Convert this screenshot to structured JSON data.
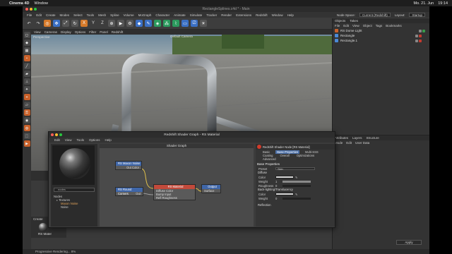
{
  "menubar": {
    "app": "Cinema 4D",
    "items": [
      "Window"
    ],
    "right": [
      "Mo. 21. Jun",
      "19:14"
    ]
  },
  "window": {
    "title": "RectangleSplines.c4d * - Main",
    "menu": [
      "File",
      "Edit",
      "Create",
      "Modes",
      "Select",
      "Tools",
      "Mesh",
      "Spline",
      "Volume",
      "MoGraph",
      "Character",
      "Animate",
      "Simulate",
      "Tracker",
      "Render",
      "Extensions",
      "Redshift",
      "Window",
      "Help"
    ],
    "node_space_label": "Node Space:",
    "node_space_value": "Current (Redshift)",
    "layout_label": "Layout:",
    "layout_value": "Startup"
  },
  "viewport": {
    "menu": [
      "View",
      "Cameras",
      "Display",
      "Options",
      "Filter",
      "Panel",
      "Redshift"
    ],
    "camera": "Default Camera",
    "label": "Perspective"
  },
  "objects": {
    "tabs": [
      "Objects",
      "Takes"
    ],
    "menu": [
      "File",
      "Edit",
      "View",
      "Object",
      "Tags",
      "Bookmarks"
    ],
    "rows": [
      {
        "name": "RS Dome Light",
        "color": "#c9612a"
      },
      {
        "name": "Rectangle",
        "color": "#4b8ad6"
      },
      {
        "name": "Rectangle.1",
        "color": "#4b8ad6"
      }
    ]
  },
  "attributes": {
    "tabs": [
      "Attributes",
      "Layers",
      "Structure"
    ],
    "menu": [
      "Mode",
      "Edit",
      "User Data"
    ],
    "buttons": [
      "Apply"
    ]
  },
  "materials": {
    "menu": [
      "Create"
    ],
    "name": "RS Mater"
  },
  "status": {
    "text": "Progressive Rendering... 8%"
  },
  "rsg": {
    "title": "Redshift Shader Graph - RS Material",
    "menu": [
      "Edit",
      "View",
      "Tools",
      "Options",
      "Help"
    ],
    "preview_label": "Nodes",
    "search_placeholder": "nodes",
    "tree": [
      "Nodes",
      "Textures",
      "Maxon Noise",
      "Noise"
    ],
    "graph_title": "Shader Graph",
    "nodes": {
      "noise": {
        "title": "RS Maxon Noise",
        "out": "Out Color",
        "color": "#3f66a8"
      },
      "corners": {
        "title": "RS Round Corners",
        "out": "Out",
        "color": "#3f66a8"
      },
      "material": {
        "title": "RS Material",
        "in": [
          "Diffuse Color",
          "Bump Input",
          "Refl Roughness"
        ],
        "out": "Out Color",
        "color": "#c24a3b"
      },
      "output": {
        "title": "Output",
        "in": "Surface",
        "color": "#3f66a8"
      }
    },
    "props": {
      "header": "Redshift Shader Node [RS Material]",
      "tabs": [
        "Basic",
        "Base Properties",
        "Multi-SSS",
        "Coating",
        "Overall",
        "Optimizations",
        "Advanced"
      ],
      "active_tab": "Base Properties",
      "section": "Base Properties",
      "preset_label": "Preset",
      "preset_value": "Skin",
      "diffuse_section": "Diffuse",
      "color_label": "Color",
      "weight_label": "Weight",
      "weight_value": "1",
      "roughness_label": "Roughness",
      "roughness_value": "0",
      "backlight_section": "Back-lighting/Translucency",
      "bl_color_label": "Color",
      "bl_weight_label": "Weight",
      "bl_weight_value": "0",
      "reflection_section": "Reflection"
    }
  }
}
